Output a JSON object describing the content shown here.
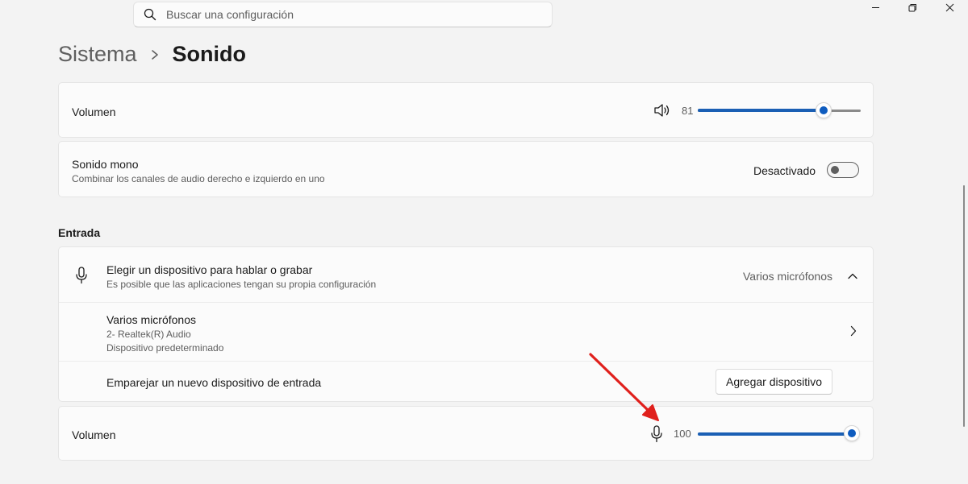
{
  "search": {
    "placeholder": "Buscar una configuración"
  },
  "breadcrumb": {
    "parent": "Sistema",
    "current": "Sonido"
  },
  "output_volume": {
    "label": "Volumen",
    "value": "81",
    "level": 0.81
  },
  "mono": {
    "title": "Sonido mono",
    "subtitle": "Combinar los canales de audio derecho e izquierdo en uno",
    "state_label": "Desactivado"
  },
  "input": {
    "section_title": "Entrada",
    "choose_device": {
      "title": "Elegir un dispositivo para hablar o grabar",
      "subtitle": "Es posible que las aplicaciones tengan su propia configuración",
      "selected": "Varios micrófonos"
    },
    "device": {
      "name": "Varios micrófonos",
      "line1": "2- Realtek(R) Audio",
      "line2": "Dispositivo predeterminado"
    },
    "pair": {
      "label": "Emparejar un nuevo dispositivo de entrada",
      "button": "Agregar dispositivo"
    },
    "volume": {
      "label": "Volumen",
      "value": "100",
      "level": 1.0
    }
  },
  "colors": {
    "accent": "#0f5cbf",
    "annotation_arrow": "#e0201c"
  }
}
